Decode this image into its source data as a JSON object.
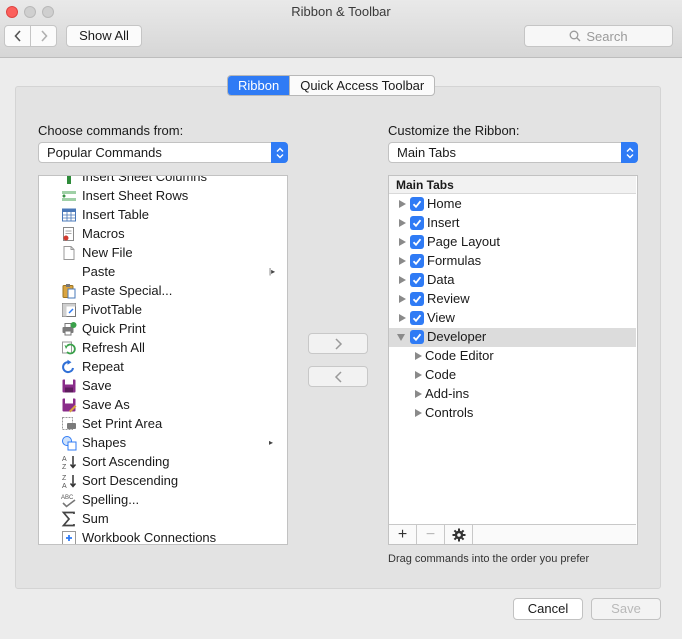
{
  "window": {
    "title": "Ribbon & Toolbar"
  },
  "toolbar": {
    "show_all_label": "Show All",
    "search_placeholder": "Search"
  },
  "tabs": [
    {
      "label": "Ribbon",
      "active": true
    },
    {
      "label": "Quick Access Toolbar",
      "active": false
    }
  ],
  "left": {
    "label": "Choose commands from:",
    "dropdown_value": "Popular Commands",
    "commands": [
      {
        "label": "Insert Sheet Columns",
        "icon": "insert-columns-icon"
      },
      {
        "label": "Insert Sheet Rows",
        "icon": "insert-rows-icon"
      },
      {
        "label": "Insert Table",
        "icon": "table-icon"
      },
      {
        "label": "Macros",
        "icon": "macro-icon"
      },
      {
        "label": "New File",
        "icon": "new-file-icon"
      },
      {
        "label": "Paste",
        "icon": "",
        "submenu": true
      },
      {
        "label": "Paste Special...",
        "icon": "paste-icon"
      },
      {
        "label": "PivotTable",
        "icon": "pivot-table-icon"
      },
      {
        "label": "Quick Print",
        "icon": "print-icon"
      },
      {
        "label": "Refresh All",
        "icon": "refresh-icon"
      },
      {
        "label": "Repeat",
        "icon": "repeat-icon"
      },
      {
        "label": "Save",
        "icon": "save-icon"
      },
      {
        "label": "Save As",
        "icon": "save-as-icon"
      },
      {
        "label": "Set Print Area",
        "icon": "print-area-icon"
      },
      {
        "label": "Shapes",
        "icon": "shapes-icon",
        "submenu": true
      },
      {
        "label": "Sort Ascending",
        "icon": "sort-ascending-icon"
      },
      {
        "label": "Sort Descending",
        "icon": "sort-descending-icon"
      },
      {
        "label": "Spelling...",
        "icon": "spelling-icon"
      },
      {
        "label": "Sum",
        "icon": "sum-icon"
      },
      {
        "label": "Workbook Connections",
        "icon": "connections-icon"
      }
    ]
  },
  "right": {
    "label": "Customize the Ribbon:",
    "dropdown_value": "Main Tabs",
    "tree_header": "Main Tabs",
    "tabs": [
      {
        "label": "Home",
        "checked": true
      },
      {
        "label": "Insert",
        "checked": true
      },
      {
        "label": "Page Layout",
        "checked": true
      },
      {
        "label": "Formulas",
        "checked": true
      },
      {
        "label": "Data",
        "checked": true
      },
      {
        "label": "Review",
        "checked": true
      },
      {
        "label": "View",
        "checked": true
      },
      {
        "label": "Developer",
        "checked": true,
        "expanded": true,
        "selected": true
      }
    ],
    "developer_groups": [
      "Code Editor",
      "Code",
      "Add-ins",
      "Controls"
    ],
    "hint": "Drag commands into the order you prefer"
  },
  "footer": {
    "cancel_label": "Cancel",
    "save_label": "Save"
  }
}
